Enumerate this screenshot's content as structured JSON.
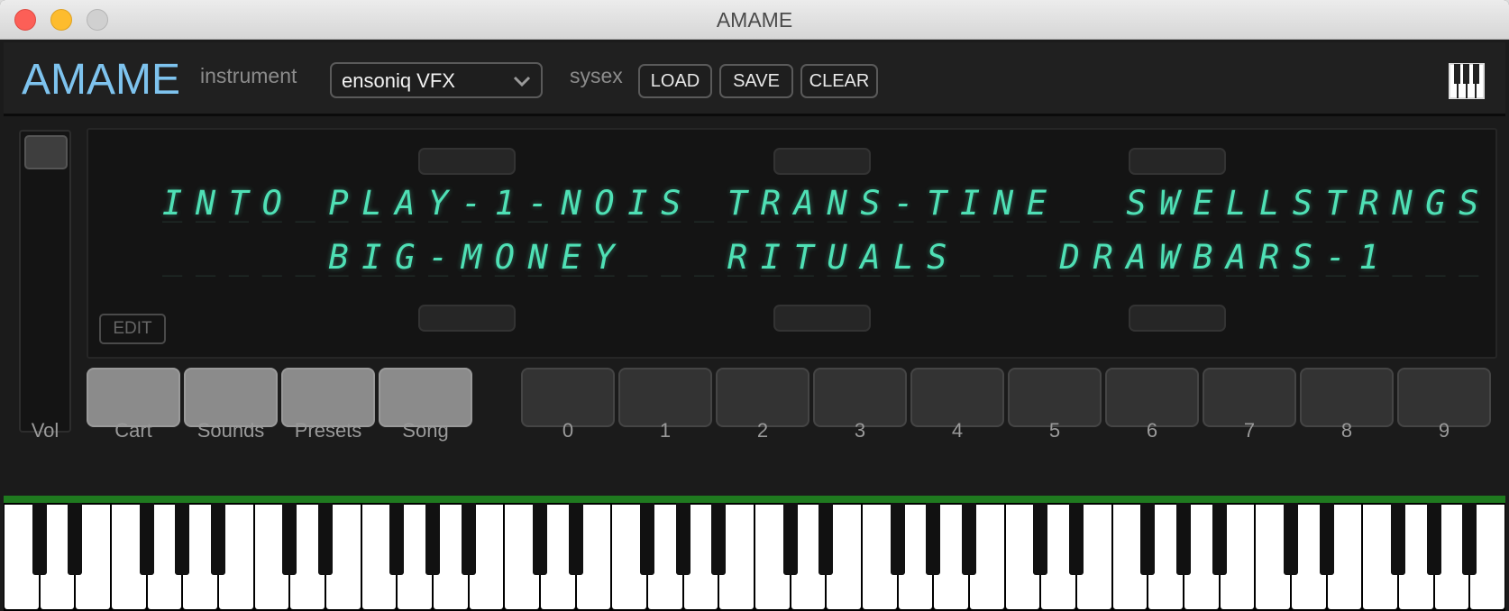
{
  "window": {
    "title": "AMAME"
  },
  "header": {
    "logo": "AMAME",
    "instrument_label": "instrument",
    "instrument_value": "ensoniq VFX",
    "sysex_label": "sysex",
    "load_label": "LOAD",
    "save_label": "SAVE",
    "clear_label": "CLEAR"
  },
  "display": {
    "row1": "INTO PLAY-1-NOIS TRANS-TINE  SWELLSTRNGS",
    "row2": "     BIG-MONEY   RITUALS   DRAWBARS-1 ",
    "ghost_row": "________________________________________",
    "edit_label": "EDIT"
  },
  "volume": {
    "label": "Vol",
    "level": 1.0
  },
  "mode_buttons": [
    "Cart",
    "Sounds",
    "Presets",
    "Song"
  ],
  "number_buttons": [
    "0",
    "1",
    "2",
    "3",
    "4",
    "5",
    "6",
    "7",
    "8",
    "9"
  ],
  "colors": {
    "logo": "#7ec3ee",
    "vfd": "#4fe0b5",
    "keyboard_accent": "#1f7a1f"
  }
}
